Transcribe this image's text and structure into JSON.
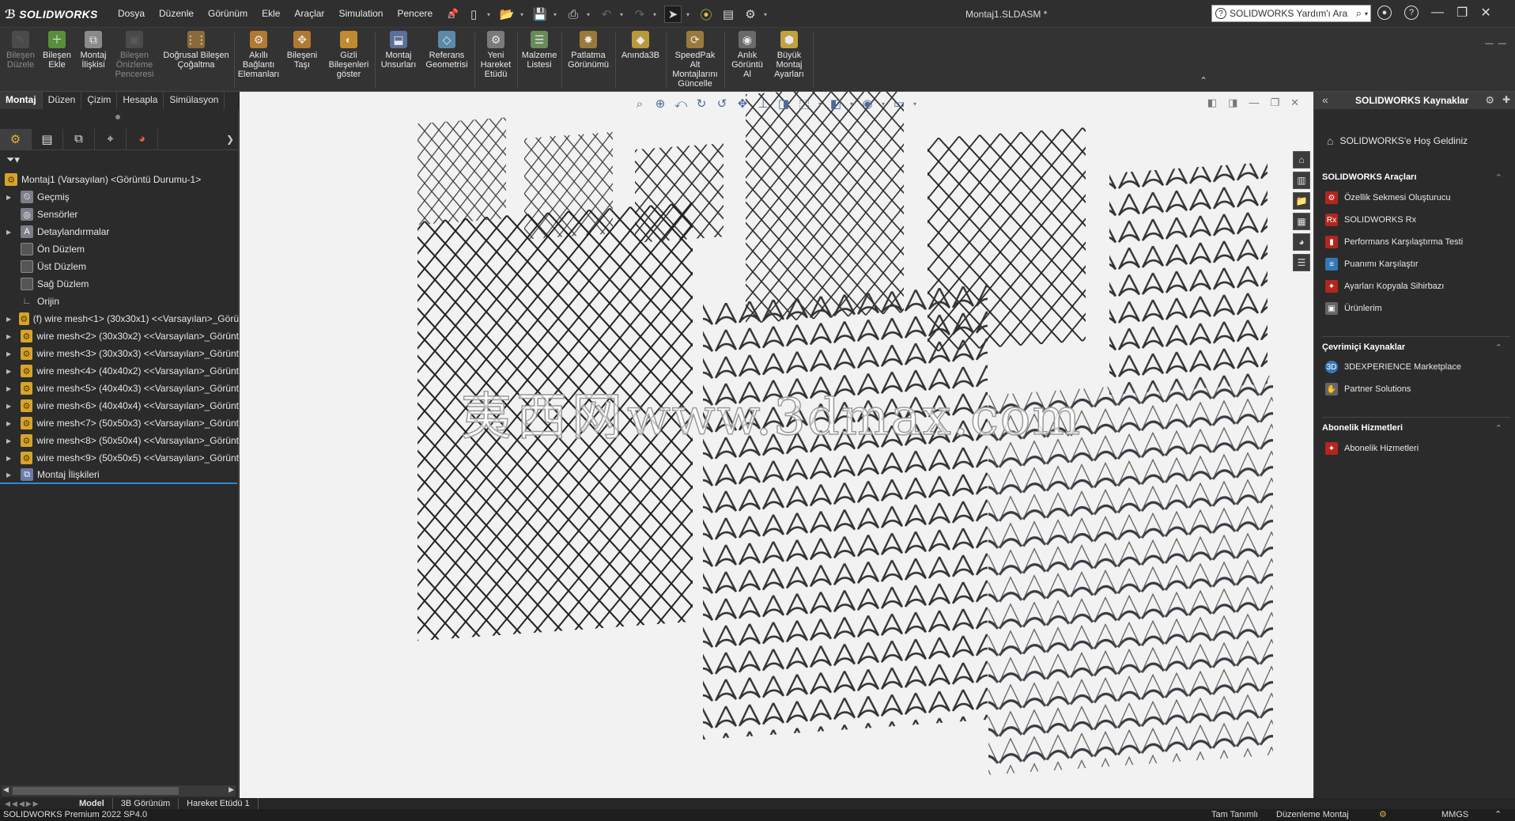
{
  "app": {
    "brand": "SOLIDWORKS",
    "document_title": "Montaj1.SLDASM *",
    "search_placeholder": "SOLIDWORKS Yardım'ı Ara"
  },
  "menu": [
    "Dosya",
    "Düzenle",
    "Görünüm",
    "Ekle",
    "Araçlar",
    "Simulation",
    "Pencere"
  ],
  "ribbon": [
    {
      "label": "Bileşen Düzele",
      "enabled": false,
      "icon": "edit-component-icon"
    },
    {
      "label": "Bileşen Ekle",
      "enabled": true,
      "icon": "insert-component-icon"
    },
    {
      "label": "Montaj İlişkisi",
      "enabled": true,
      "icon": "mate-icon"
    },
    {
      "label": "Bileşen Önizleme Penceresi",
      "enabled": false,
      "icon": "component-preview-icon"
    },
    {
      "label": "Doğrusal Bileşen Çoğaltma",
      "enabled": true,
      "icon": "linear-pattern-icon"
    },
    {
      "label": "Akıllı Bağlantı Elemanları",
      "enabled": true,
      "icon": "smart-fasteners-icon"
    },
    {
      "label": "Bileşeni Taşı",
      "enabled": true,
      "icon": "move-component-icon"
    },
    {
      "label": "Gizli Bileşenleri göster",
      "enabled": true,
      "icon": "show-hidden-icon"
    },
    {
      "label": "Montaj Unsurları",
      "enabled": true,
      "icon": "assembly-features-icon"
    },
    {
      "label": "Referans Geometrisi",
      "enabled": true,
      "icon": "reference-geometry-icon"
    },
    {
      "label": "Yeni Hareket Etüdü",
      "enabled": true,
      "icon": "motion-study-icon"
    },
    {
      "label": "Malzeme Listesi",
      "enabled": true,
      "icon": "bom-icon"
    },
    {
      "label": "Patlatma Görünümü",
      "enabled": true,
      "icon": "exploded-view-icon"
    },
    {
      "label": "Anında3B",
      "enabled": true,
      "icon": "instant3d-icon"
    },
    {
      "label": "SpeedPak Alt Montajlarını Güncelle",
      "enabled": true,
      "icon": "speedpak-icon"
    },
    {
      "label": "Anlık Görüntü Al",
      "enabled": true,
      "icon": "snapshot-icon"
    },
    {
      "label": "Büyük Montaj Ayarları",
      "enabled": true,
      "icon": "large-assembly-icon"
    }
  ],
  "command_tabs": [
    "Montaj",
    "Düzen",
    "Çizim",
    "Hesapla",
    "Simülasyon"
  ],
  "active_command_tab": "Montaj",
  "tree": {
    "root": "Montaj1 (Varsayılan) <Görüntü Durumu-1>",
    "items": [
      {
        "label": "Geçmiş",
        "icon": "history-icon",
        "expandable": true
      },
      {
        "label": "Sensörler",
        "icon": "sensor-icon",
        "expandable": false
      },
      {
        "label": "Detaylandırmalar",
        "icon": "annotations-icon",
        "expandable": true
      },
      {
        "label": "Ön Düzlem",
        "icon": "plane-icon",
        "expandable": false
      },
      {
        "label": "Üst Düzlem",
        "icon": "plane-icon",
        "expandable": false
      },
      {
        "label": "Sağ Düzlem",
        "icon": "plane-icon",
        "expandable": false
      },
      {
        "label": "Orijin",
        "icon": "origin-icon",
        "expandable": false
      },
      {
        "label": "(f) wire mesh<1> (30x30x1) <<Varsayılan>_Görü",
        "icon": "part-icon",
        "expandable": true
      },
      {
        "label": "wire mesh<2> (30x30x2) <<Varsayılan>_Görünt",
        "icon": "part-icon",
        "expandable": true
      },
      {
        "label": "wire mesh<3> (30x30x3) <<Varsayılan>_Görünt",
        "icon": "part-icon",
        "expandable": true
      },
      {
        "label": "wire mesh<4> (40x40x2) <<Varsayılan>_Görünt",
        "icon": "part-icon",
        "expandable": true
      },
      {
        "label": "wire mesh<5> (40x40x3) <<Varsayılan>_Görünt",
        "icon": "part-icon",
        "expandable": true
      },
      {
        "label": "wire mesh<6> (40x40x4) <<Varsayılan>_Görünt",
        "icon": "part-icon",
        "expandable": true
      },
      {
        "label": "wire mesh<7> (50x50x3) <<Varsayılan>_Görünt",
        "icon": "part-icon",
        "expandable": true
      },
      {
        "label": "wire mesh<8> (50x50x4) <<Varsayılan>_Görünt",
        "icon": "part-icon",
        "expandable": true
      },
      {
        "label": "wire mesh<9> (50x50x5) <<Varsayılan>_Görünt",
        "icon": "part-icon",
        "expandable": true
      },
      {
        "label": "Montaj İlişkileri",
        "icon": "mates-folder-icon",
        "expandable": true
      }
    ]
  },
  "viewport": {
    "watermark_cn": "夷西网",
    "watermark_url": "www.3dmax.com"
  },
  "task_pane": {
    "title": "SOLIDWORKS Kaynaklar",
    "welcome": "SOLIDWORKS'e Hoş Geldiniz",
    "sections": [
      {
        "title": "SOLIDWORKS Araçları",
        "items": [
          "Özellik Sekmesi Oluşturucu",
          "SOLIDWORKS Rx",
          "Performans Karşılaştırma Testi",
          "Puanımı Karşılaştır",
          "Ayarları Kopyala Sihirbazı",
          "Ürünlerim"
        ]
      },
      {
        "title": "Çevrimiçi Kaynaklar",
        "items": [
          "3DEXPERIENCE Marketplace",
          "Partner Solutions"
        ]
      },
      {
        "title": "Abonelik Hizmetleri",
        "items": [
          "Abonelik Hizmetleri"
        ]
      }
    ]
  },
  "bottom_tabs": [
    "Model",
    "3B Görünüm",
    "Hareket Etüdü 1"
  ],
  "status": {
    "version": "SOLIDWORKS Premium 2022 SP4.0",
    "definition": "Tam Tanımlı",
    "mode": "Düzenleme Montaj",
    "units": "MMGS"
  },
  "colors": {
    "background": "#2b2b2b",
    "viewport": "#f2f2f2",
    "accent": "#2a8cd8",
    "mesh_wire": "#2a2a2a"
  }
}
